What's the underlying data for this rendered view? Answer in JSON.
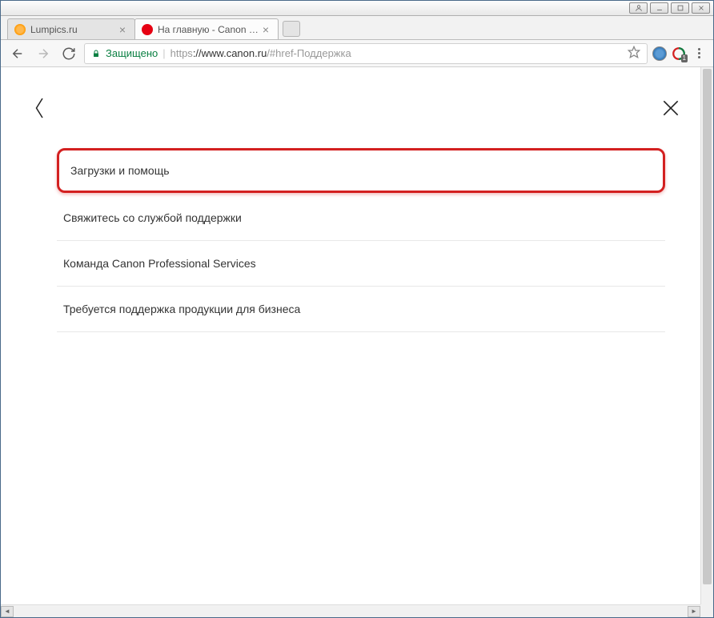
{
  "window": {
    "user_btn": "user",
    "min_btn": "minimize",
    "max_btn": "maximize",
    "close_btn": "close"
  },
  "tabs": [
    {
      "title": "Lumpics.ru",
      "active": false
    },
    {
      "title": "На главную - Canon Рос",
      "active": true
    }
  ],
  "toolbar": {
    "secure_label": "Защищено",
    "url_protocol": "https",
    "url_host": "://www.canon.ru",
    "url_path": "/#href-Поддержка",
    "ext_badge": "1"
  },
  "page": {
    "items": [
      "Загрузки и помощь",
      "Свяжитесь со службой поддержки",
      "Команда Canon Professional Services",
      "Требуется поддержка продукции для бизнеса"
    ]
  }
}
